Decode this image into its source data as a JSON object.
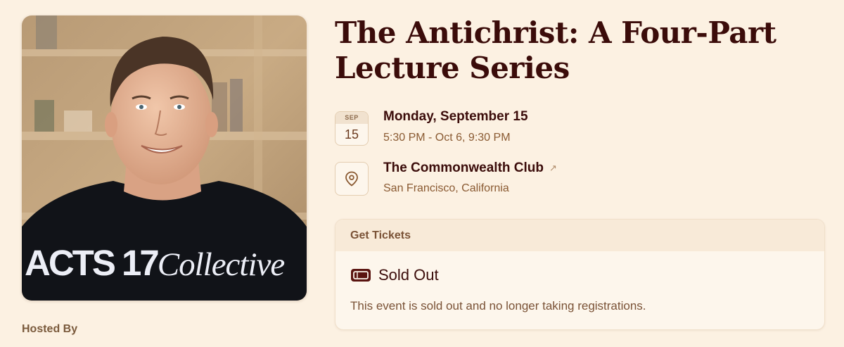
{
  "event": {
    "title_line1": "The Antichrist: A Four-Part",
    "title_line2": "Lecture Series"
  },
  "cover": {
    "brand_bold": "ACTS 17",
    "brand_italic": "Collective"
  },
  "date": {
    "month": "SEP",
    "day": "15",
    "main": "Monday, September 15",
    "time_range": "5:30 PM - Oct 6, 9:30 PM"
  },
  "location": {
    "venue": "The Commonwealth Club",
    "venue_arrow": "↗",
    "city": "San Francisco, California",
    "icon": "map-pin-icon"
  },
  "tickets": {
    "heading": "Get Tickets",
    "status": "Sold Out",
    "status_icon": "ticket-icon",
    "description": "This event is sold out and no longer taking registrations."
  },
  "host": {
    "label": "Hosted By"
  },
  "colors": {
    "background": "#fcf1e2",
    "title": "#3b0c0a",
    "muted": "#8a5a32"
  }
}
